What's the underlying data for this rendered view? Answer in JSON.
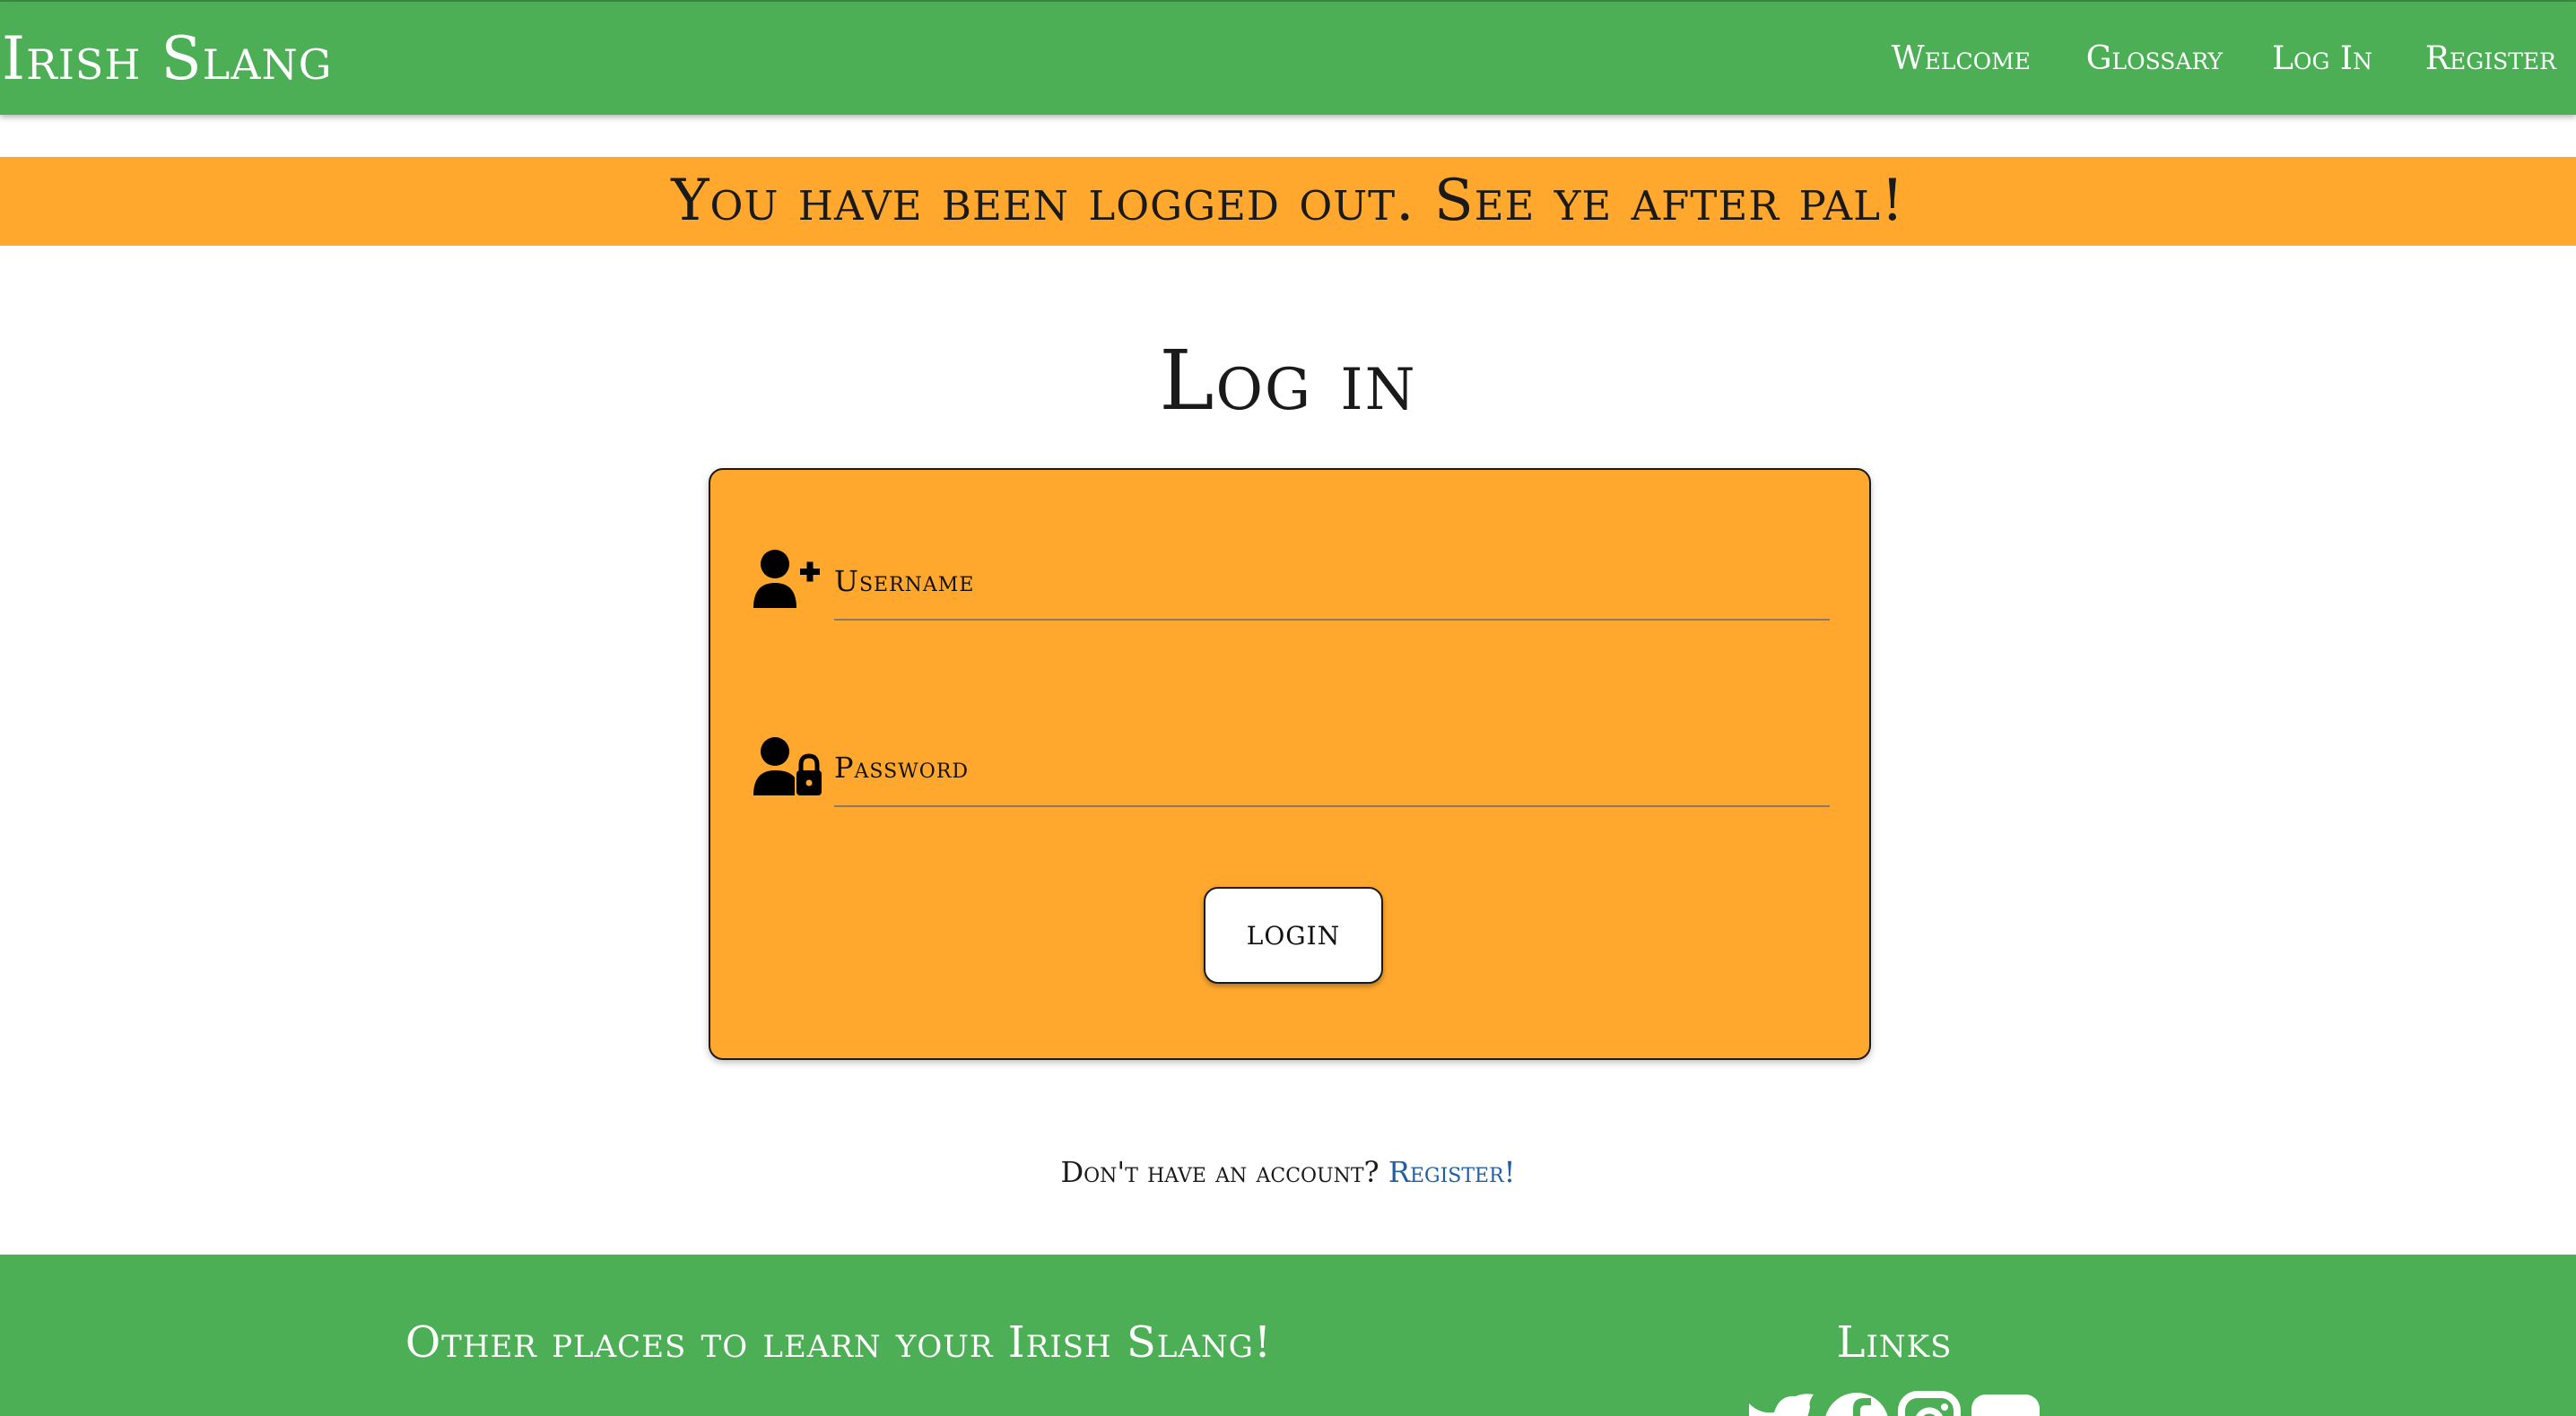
{
  "header": {
    "brand": "Irish Slang",
    "nav": {
      "welcome": "Welcome",
      "glossary": "Glossary",
      "login": "Log In",
      "register": "Register"
    }
  },
  "flash": {
    "message": "You have been logged out. See ye after pal!"
  },
  "login_form": {
    "title": "Log in",
    "username_label": "Username",
    "password_label": "Password",
    "submit_label": "LOGIN"
  },
  "register_prompt": {
    "text": "Don't have an account?",
    "link": "Register!"
  },
  "footer": {
    "left_heading": "Other places to learn your Irish Slang!",
    "right_heading": "Links",
    "social_icons": [
      "twitter-icon",
      "facebook-icon",
      "instagram-icon",
      "youtube-icon"
    ]
  },
  "colors": {
    "navbar": "#4caf55",
    "accent_orange": "#ffa82d",
    "link_blue": "#1f5fa8"
  }
}
